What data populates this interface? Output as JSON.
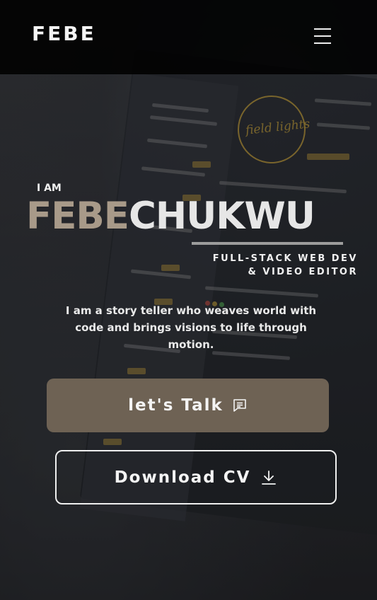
{
  "header": {
    "logo": "FEBE",
    "menu_icon": "hamburger-menu-icon"
  },
  "hero": {
    "intro": "I AM",
    "name_first": "FEBE",
    "name_last": "CHUKWU",
    "role_line1": "FULL-STACK WEB DEV",
    "role_line2": "& VIDEO EDITOR",
    "tagline": "I am a story teller who weaves world with code and brings visions to life through motion."
  },
  "actions": {
    "talk_label": "let's Talk",
    "talk_icon": "chat-icon",
    "cv_label": "Download CV",
    "cv_icon": "download-icon"
  },
  "colors": {
    "accent": "#6e6254",
    "name_first": "#a89a89",
    "name_last": "#e6e6e6",
    "navbar": "#000000"
  }
}
